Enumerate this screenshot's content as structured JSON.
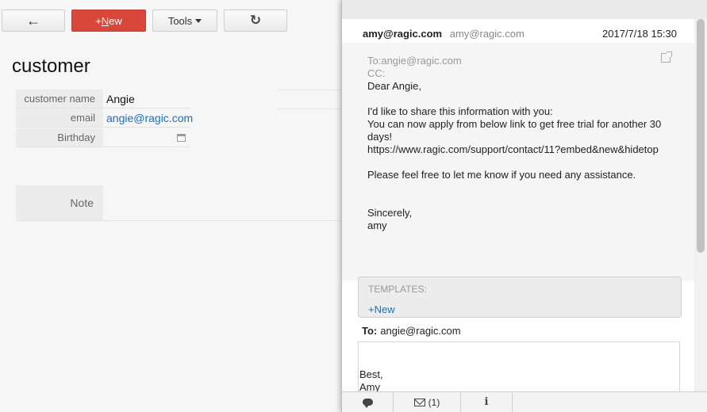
{
  "toolbar": {
    "back_icon": "←",
    "new_plus": "+",
    "new_first": "N",
    "new_rest": "ew",
    "tools_label": "Tools",
    "refresh_icon": "↻"
  },
  "form": {
    "title": "customer",
    "fields": [
      {
        "label": "customer name",
        "value": "Angie"
      },
      {
        "label": "email",
        "value": "angie@ragic.com"
      },
      {
        "label": "Birthday",
        "value": ""
      }
    ],
    "note_label": "Note"
  },
  "email": {
    "from_name": "amy@ragic.com",
    "from_address": "amy@ragic.com",
    "date": "2017/7/18 15:30",
    "to_line": "To:angie@ragic.com",
    "cc_line": "CC:",
    "body": {
      "greeting": "Dear Angie,",
      "line1": "I'd like to share this information with you:",
      "line2": "You can now apply from below link to get free trial for another 30",
      "line3": "days!",
      "link": "https://www.ragic.com/support/contact/11?embed&new&hidetop",
      "line4": "Please feel free to let me know if you need any assistance.",
      "closing": "Sincerely,",
      "signature": "amy"
    },
    "templates": {
      "label": "TEMPLATES:",
      "new_label": "+New"
    },
    "compose": {
      "to_label": "To:",
      "to_value": "angie@ragic.com",
      "text_line1": "Best,",
      "text_line2": "Amy"
    }
  },
  "panel_tabs": {
    "mail_count": "(1)"
  },
  "colors": {
    "new_button": "#d9473a",
    "link": "#1a6fc0"
  },
  "icons": {
    "back": "arrow-left-icon",
    "refresh": "refresh-icon",
    "calendar": "calendar-icon",
    "external": "external-link-icon",
    "comments": "comments-icon",
    "mail": "mail-icon",
    "info": "info-icon"
  }
}
